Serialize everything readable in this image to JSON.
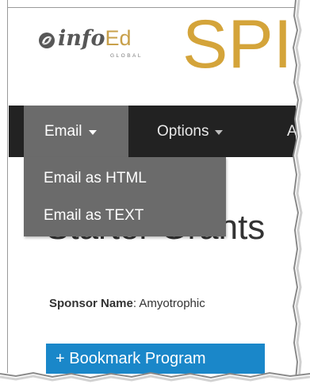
{
  "header": {
    "logo_text_info": "info",
    "logo_text_ed": "Ed",
    "logo_subtext": "GLOBAL",
    "app_title_partial": "SPI"
  },
  "navbar": {
    "items": [
      {
        "label": "Email",
        "active": true
      },
      {
        "label": "Options",
        "active": false
      },
      {
        "label": "A",
        "active": false
      }
    ]
  },
  "dropdown": {
    "items": [
      {
        "label": "Email as HTML"
      },
      {
        "label": "Email as TEXT"
      }
    ]
  },
  "main": {
    "title": "Starter Grants",
    "sponsor_label": "Sponsor Name",
    "sponsor_value": ": Amyotrophic",
    "bookmark_button": "+ Bookmark Program"
  },
  "colors": {
    "brand_gold": "#d4a43a",
    "navbar_bg": "#222222",
    "active_item_bg": "#6b6b6b",
    "button_blue": "#1a87c9"
  }
}
